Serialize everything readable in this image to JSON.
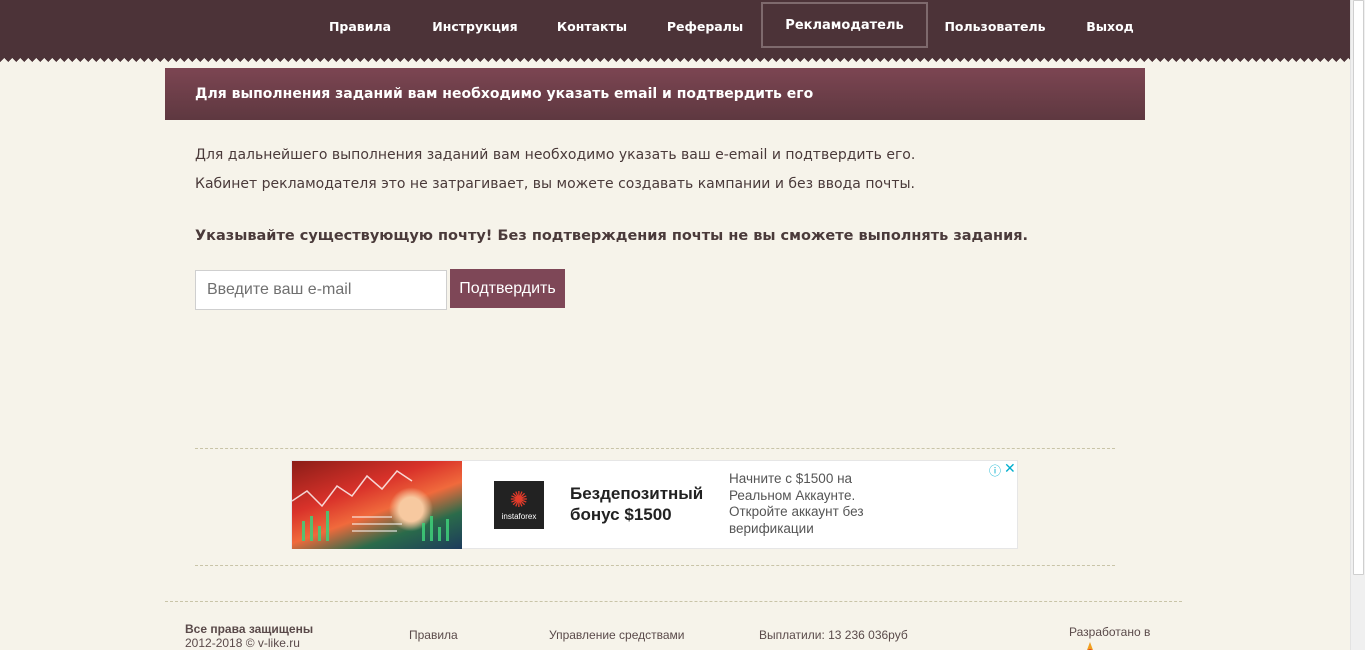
{
  "nav": {
    "items": [
      {
        "label": "Правила"
      },
      {
        "label": "Инструкция"
      },
      {
        "label": "Контакты"
      },
      {
        "label": "Рефералы"
      },
      {
        "label": "Рекламодатель"
      },
      {
        "label": "Пользователь"
      },
      {
        "label": "Выход"
      }
    ],
    "active_index": 4
  },
  "panel": {
    "title": "Для выполнения заданий вам необходимо указать email и подтвердить его",
    "line1": "Для дальнейшего выполнения заданий вам необходимо указать ваш e-email и подтвердить его.",
    "line2": "Кабинет рекламодателя это не затрагивает, вы можете создавать кампании и без ввода почты.",
    "warning": "Указывайте существующую почту! Без подтверждения почты не вы сможете выполнять задания."
  },
  "form": {
    "email_placeholder": "Введите ваш e-mail",
    "email_value": "",
    "submit_label": "Подтвердить"
  },
  "ad": {
    "logo_text": "instaforex",
    "headline": "Бездепозитный бонус $1500",
    "body": "Начните с $1500 на Реальном Аккаунте. Откройте аккаунт без верификации",
    "info_icon": "info-icon",
    "close_icon": "close-icon"
  },
  "footer": {
    "rights": "Все права защищены",
    "copyright": "2012-2018 © v-like.ru",
    "link_rules": "Правила",
    "link_funds": "Управление средствами",
    "paid_out": "Выплатили: 13 236 036руб",
    "developed_in": "Разработано в"
  },
  "colors": {
    "nav_bg": "#4c3338",
    "accent": "#7e4757",
    "page_bg": "#f6f3ea",
    "ad_icon": "#00aecd"
  }
}
